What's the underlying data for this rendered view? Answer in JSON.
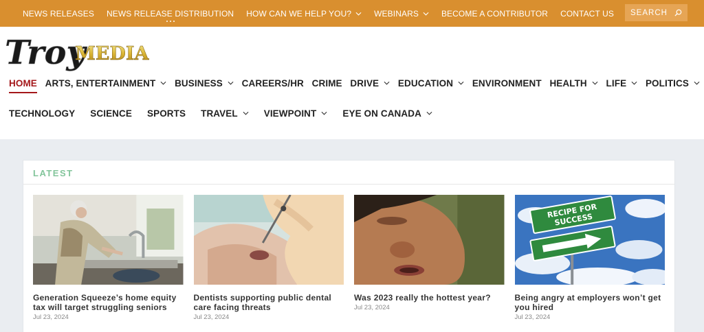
{
  "topbar": {
    "items": [
      {
        "label": "NEWS RELEASES"
      },
      {
        "label": "NEWS RELEASE DISTRIBUTION"
      },
      {
        "label": "HOW CAN WE HELP YOU?"
      },
      {
        "label": "WEBINARS"
      },
      {
        "label": "BECOME A CONTRIBUTOR"
      },
      {
        "label": "CONTACT US"
      }
    ],
    "search_placeholder": "SEARCH"
  },
  "logo": {
    "part1": "Troy",
    "part2": "MEDIA"
  },
  "nav": {
    "row1": [
      {
        "label": "HOME"
      },
      {
        "label": "ARTS, ENTERTAINMENT"
      },
      {
        "label": "BUSINESS"
      },
      {
        "label": "CAREERS/HR"
      },
      {
        "label": "CRIME"
      },
      {
        "label": "DRIVE"
      },
      {
        "label": "EDUCATION"
      },
      {
        "label": "ENVIRONMENT"
      },
      {
        "label": "HEALTH"
      },
      {
        "label": "LIFE"
      },
      {
        "label": "POLITICS"
      }
    ],
    "row2": [
      {
        "label": "TECHNOLOGY"
      },
      {
        "label": "SCIENCE"
      },
      {
        "label": "SPORTS"
      },
      {
        "label": "TRAVEL"
      },
      {
        "label": "VIEWPOINT"
      },
      {
        "label": "EYE ON CANADA"
      }
    ]
  },
  "latest": {
    "heading": "LATEST",
    "articles": [
      {
        "title": "Generation Squeeze’s home equity tax will target struggling seniors",
        "date": "Jul 23, 2024"
      },
      {
        "title": "Dentists supporting public dental care facing threats",
        "date": "Jul 23, 2024"
      },
      {
        "title": "Was 2023 really the hottest year?",
        "date": "Jul 23, 2024"
      },
      {
        "title": "Being angry at employers won’t get you hired",
        "date": "Jul 23, 2024",
        "sign_top": "RECIPE FOR",
        "sign_bottom": "SUCCESS"
      }
    ]
  },
  "colors": {
    "topbar": "#d98f2f",
    "active": "#a4171a",
    "latest": "#83c59b",
    "page_bg": "#eaedf1"
  }
}
